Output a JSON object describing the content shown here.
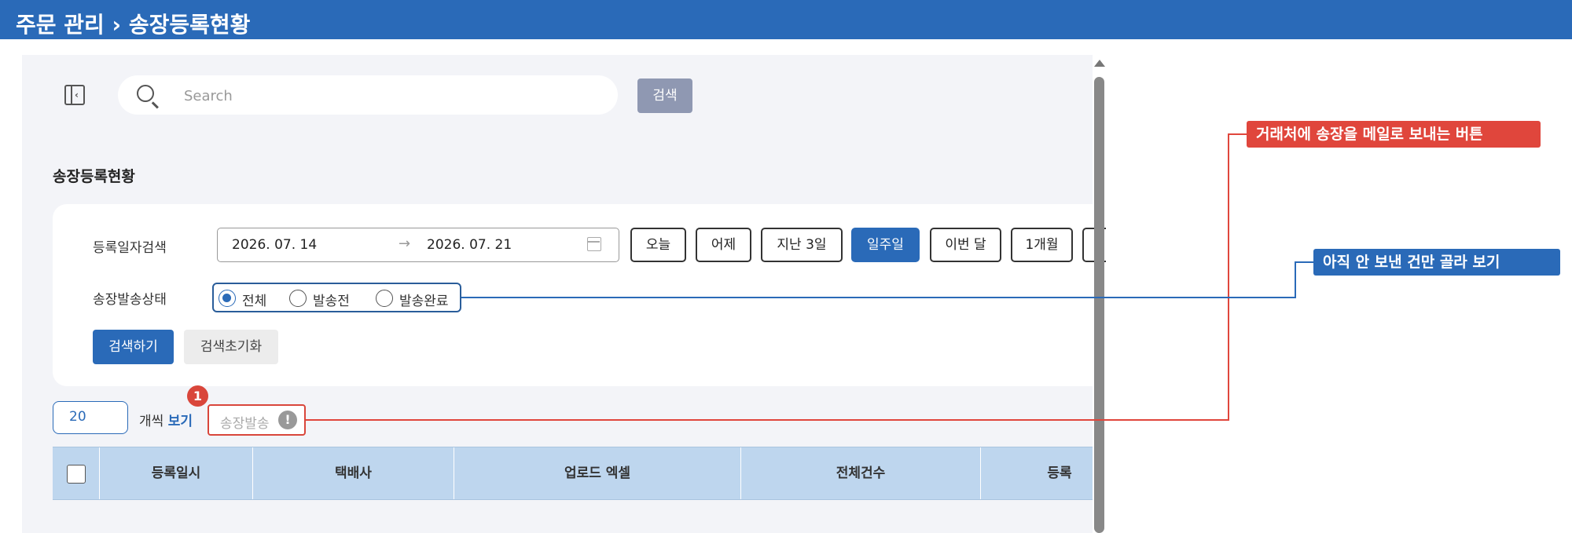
{
  "header": {
    "title": "주문 관리 › 송장등록현황"
  },
  "search": {
    "placeholder": "Search",
    "button_label": "검색"
  },
  "section": {
    "title": "송장등록현황"
  },
  "filters": {
    "date_label": "등록일자검색",
    "date_from": "2026. 07. 14",
    "date_arrow": "→",
    "date_to": "2026. 07. 21",
    "quick_ranges": [
      {
        "label": "오늘",
        "active": false
      },
      {
        "label": "어제",
        "active": false
      },
      {
        "label": "지난 3일",
        "active": false
      },
      {
        "label": "일주일",
        "active": true
      },
      {
        "label": "이번 달",
        "active": false
      },
      {
        "label": "1개월",
        "active": false
      }
    ],
    "status_label": "송장발송상태",
    "status_options": [
      {
        "label": "전체",
        "checked": true
      },
      {
        "label": "발송전",
        "checked": false
      },
      {
        "label": "발송완료",
        "checked": false
      }
    ],
    "submit_label": "검색하기",
    "reset_label": "검색초기화"
  },
  "toolbar": {
    "page_size": "20",
    "per_page_prefix": "개씩",
    "per_page_view": "보기",
    "send_label": "송장발송",
    "info_glyph": "!",
    "step_badge": "1"
  },
  "table": {
    "columns": [
      "등록일시",
      "택배사",
      "업로드 엑셀",
      "전체건수",
      "등록"
    ]
  },
  "annotations": {
    "send_button_note": "거래처에 송장을 메일로 보내는 버튼",
    "status_filter_note": "아직 안 보낸 건만 골라 보기"
  },
  "colors": {
    "accent": "#2a6ab8",
    "callout_red": "#e0463c",
    "callout_blue": "#2a6ab8"
  }
}
